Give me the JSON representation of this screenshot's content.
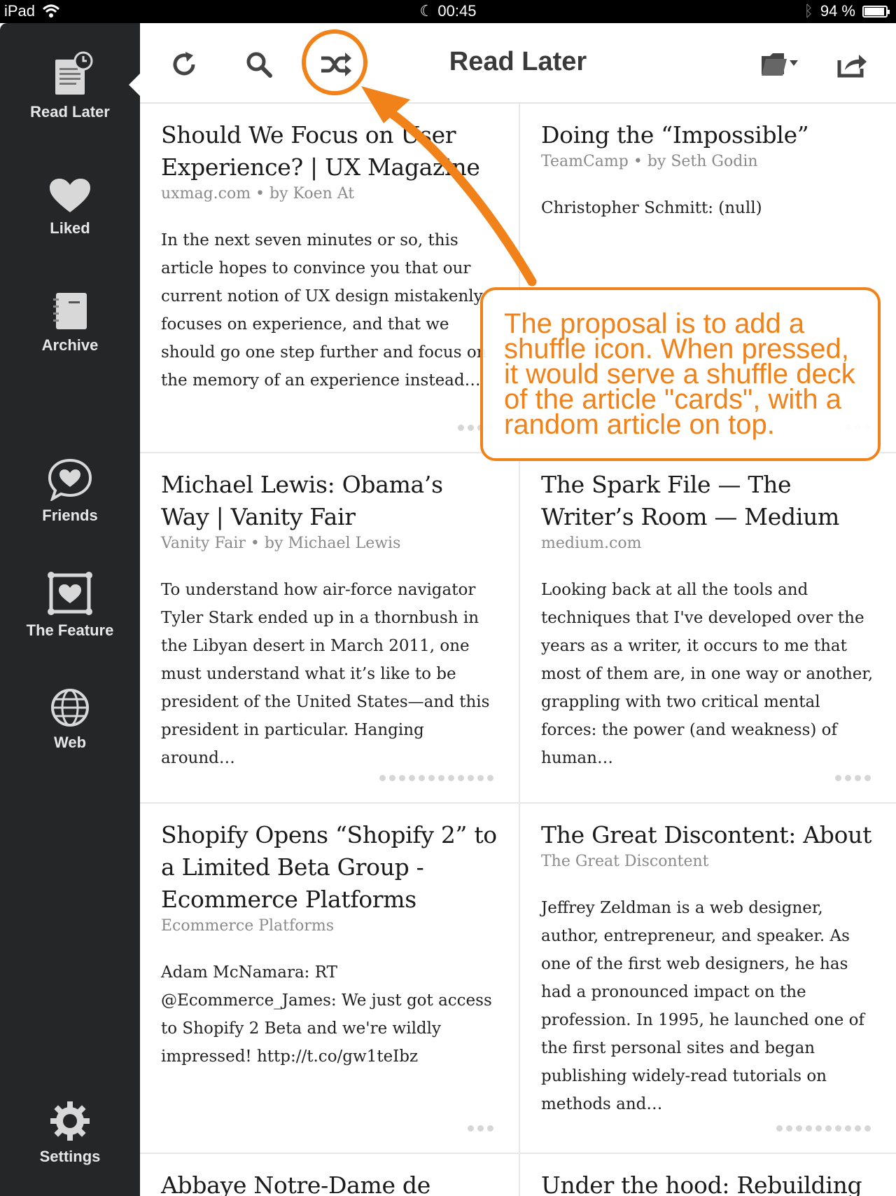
{
  "status_bar": {
    "device": "iPad",
    "time": "00:45",
    "battery": "94 %",
    "battery_level": 0.94,
    "icons": [
      "wifi-icon",
      "moon-icon",
      "bluetooth-icon",
      "battery-icon"
    ]
  },
  "sidebar": {
    "items": [
      {
        "label": "Read Later",
        "icon": "read-later-icon",
        "selected": true
      },
      {
        "label": "Liked",
        "icon": "heart-icon"
      },
      {
        "label": "Archive",
        "icon": "archive-icon"
      },
      {
        "label": "Friends",
        "icon": "friends-icon"
      },
      {
        "label": "The Feature",
        "icon": "feature-icon"
      },
      {
        "label": "Web",
        "icon": "globe-icon"
      },
      {
        "label": "Settings",
        "icon": "gear-icon"
      }
    ]
  },
  "toolbar": {
    "title": "Read Later",
    "buttons": [
      "refresh-icon",
      "search-icon",
      "shuffle-icon",
      "folder-icon",
      "share-icon"
    ]
  },
  "articles": [
    {
      "title": "Should We Focus on User Experience? | UX Magazine",
      "meta": "uxmag.com • by Koen At",
      "excerpt": "In the next seven minutes or so, this article hopes to convince you that our current notion of UX design mistakenly focuses on experience, and that we should go one step further and focus on the memory of an experience instead…",
      "pages": 4
    },
    {
      "title": "Doing the “Impossible”",
      "meta": "TeamCamp • by Seth Godin",
      "excerpt": "Christopher Schmitt: (null)",
      "pages": 3
    },
    {
      "title": "Michael Lewis: Obama’s Way | Vanity Fair",
      "meta": "Vanity Fair • by Michael Lewis",
      "excerpt": "To understand how air-force navigator Tyler Stark ended up in a thornbush in the Libyan desert in March 2011, one must understand what it’s like to be president of the United States—and this president in particular. Hanging around…",
      "pages": 12
    },
    {
      "title": "The Spark File — The Writer’s Room — Medium",
      "meta": "medium.com",
      "excerpt": "Looking back at all the tools and techniques that I've developed over the years as a writer, it occurs to me that most of them are, in one way or another, grappling with two critical mental forces: the power (and weakness) of human…",
      "pages": 4
    },
    {
      "title": "Shopify Opens “Shopify 2” to a Limited Beta Group - Ecommerce Platforms",
      "meta": "Ecommerce Platforms",
      "excerpt": "Adam McNamara: RT @Ecommerce_James: We just got access to Shopify 2 Beta and we're wildly impressed! http://t.co/gw1teIbz",
      "pages": 3
    },
    {
      "title": "The Great Discontent: About",
      "meta": "The Great Discontent",
      "excerpt": "Jeffrey Zeldman is a web designer, author, entrepreneur, and speaker. As one of the first web designers, he has had a pronounced impact on the profession. In 1995, he launched one of the first personal sites and began publishing widely-read tutorials on methods and…",
      "pages": 10
    },
    {
      "title": "Abbaye Notre-Dame de",
      "meta": "",
      "excerpt": "",
      "pages": 0
    },
    {
      "title": "Under the hood: Rebuilding",
      "meta": "",
      "excerpt": "",
      "pages": 0
    }
  ],
  "annotation": {
    "text": "The proposal is to add a shuffle icon. When pressed, it would serve a shuffle deck of the article \"cards\", with a random article on top.",
    "color": "#f08219"
  }
}
